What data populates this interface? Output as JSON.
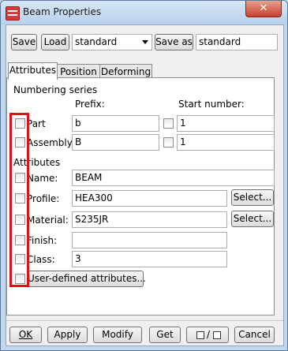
{
  "window": {
    "title": "Beam Properties",
    "close_glyph": "✕"
  },
  "toolbar": {
    "save_label": "Save",
    "load_label": "Load",
    "preset_selected": "standard",
    "save_as_label": "Save as",
    "save_as_value": "standard"
  },
  "tabs": [
    {
      "label": "Attributes",
      "active": true
    },
    {
      "label": "Position",
      "active": false
    },
    {
      "label": "Deforming",
      "active": false
    }
  ],
  "numbering": {
    "group_label": "Numbering series",
    "prefix_header": "Prefix:",
    "start_header": "Start number:",
    "rows": [
      {
        "label": "Part",
        "prefix": "b",
        "start": "1"
      },
      {
        "label": "Assembly",
        "prefix": "B",
        "start": "1"
      }
    ]
  },
  "attributes": {
    "group_label": "Attributes",
    "rows": [
      {
        "label": "Name:",
        "value": "BEAM"
      },
      {
        "label": "Profile:",
        "value": "HEA300"
      },
      {
        "label": "Material:",
        "value": "S235JR"
      },
      {
        "label": "Finish:",
        "value": ""
      },
      {
        "label": "Class:",
        "value": "3"
      }
    ],
    "select_label": "Select...",
    "user_defined_label": "User-defined attributes..."
  },
  "footer": {
    "ok_label": "OK",
    "apply_label": "Apply",
    "modify_label": "Modify",
    "get_label": "Get",
    "toggle_separator": "/",
    "cancel_label": "Cancel"
  },
  "colors": {
    "highlight_box": "#e0101a",
    "close_button": "#c7402a"
  },
  "icons": {
    "app": "beam-properties-app-icon",
    "close": "close-icon",
    "dropdown": "chevron-down-icon",
    "toggle": "check-uncheck-toggle-icon"
  }
}
